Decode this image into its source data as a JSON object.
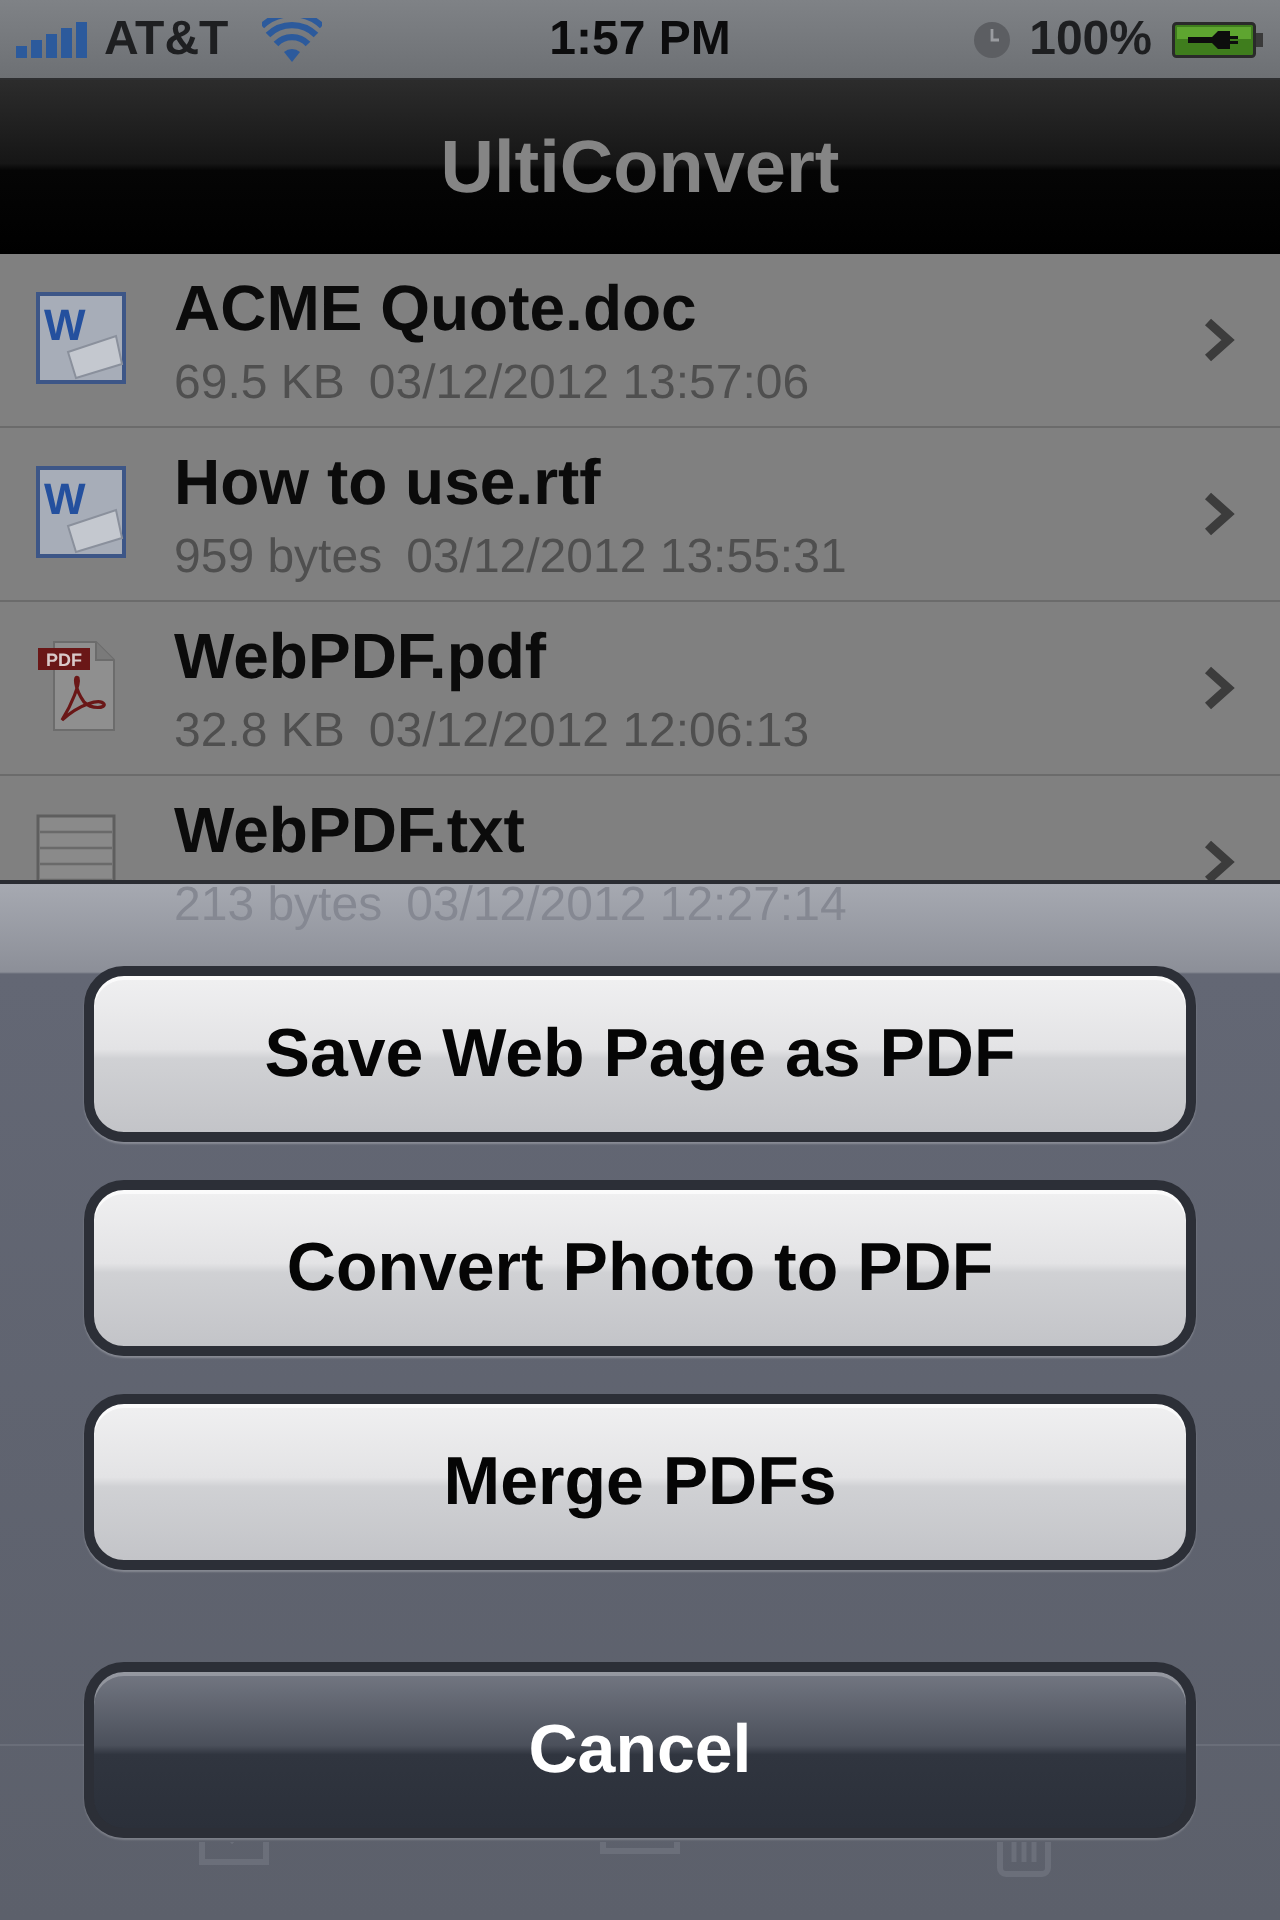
{
  "status_bar": {
    "carrier": "AT&T",
    "time": "1:57 PM",
    "battery": "100%"
  },
  "nav_bar": {
    "title": "UltiConvert"
  },
  "files": [
    {
      "kind": "word",
      "icon_label": "W",
      "name": "ACME Quote.doc",
      "size": "69.5 KB",
      "modified": "03/12/2012 13:57:06"
    },
    {
      "kind": "word",
      "icon_label": "W",
      "name": "How to use.rtf",
      "size": "959 bytes",
      "modified": "03/12/2012 13:55:31"
    },
    {
      "kind": "pdf",
      "icon_label": "PDF",
      "name": "WebPDF.pdf",
      "size": "32.8 KB",
      "modified": "03/12/2012 12:06:13"
    },
    {
      "kind": "text",
      "name": "WebPDF.txt",
      "size": "213 bytes",
      "modified": "03/12/2012 12:27:14"
    }
  ],
  "action_sheet": {
    "buttons": [
      {
        "kind": "action",
        "label": "Save Web Page as PDF"
      },
      {
        "kind": "action",
        "label": "Convert Photo to PDF"
      },
      {
        "kind": "action",
        "label": "Merge PDFs"
      },
      {
        "kind": "cancel",
        "label": "Cancel"
      }
    ]
  }
}
